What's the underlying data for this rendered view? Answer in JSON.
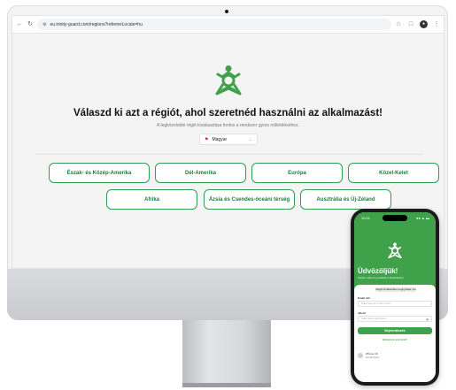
{
  "browser": {
    "url": "eu.trinity-guard.com/regions?referrerLocale=hu",
    "icons": [
      "back-arrow-icon",
      "reload-icon",
      "site-info-icon",
      "star-icon",
      "extensions-icon",
      "profile-icon",
      "menu-dots-icon"
    ]
  },
  "page": {
    "headline": "Válaszd ki azt a régiót, ahol szeretnéd használni az alkalmazást!",
    "subhead": "A legközelebbi régió kiválasztása fontos a rendszer gyors működéséhez.",
    "language": {
      "flag": "⚑",
      "selected": "Magyar"
    },
    "regions": [
      "Észak- és Közép-Amerika",
      "Dél-Amerika",
      "Európa",
      "Közel-Kelet",
      "Afrika",
      "Ázsia és Csendes-óceáni térség",
      "Ausztrália és Új-Zéland"
    ]
  },
  "phone": {
    "time": "10:41",
    "status": "●● ▲ ▬",
    "welcome": "Üdvözöljük!",
    "welcome_sub": "Kérjük, adja meg adatait a folytatáshoz",
    "region_chip": "Régió kiválasztás megnyitása: Hu",
    "email_label": "Email cím",
    "email_placeholder": "Adja meg az email címét",
    "password_label": "Jelszó",
    "password_placeholder": "Adja meg a jelszavát",
    "login": "Bejelentkezés",
    "forgot": "Elfelejtette jelszavát?",
    "device_name": "iPhone 16",
    "device_sub": "Eszközlista"
  },
  "colors": {
    "brand_green": "#3fa24a",
    "button_border": "#2e9e52"
  }
}
